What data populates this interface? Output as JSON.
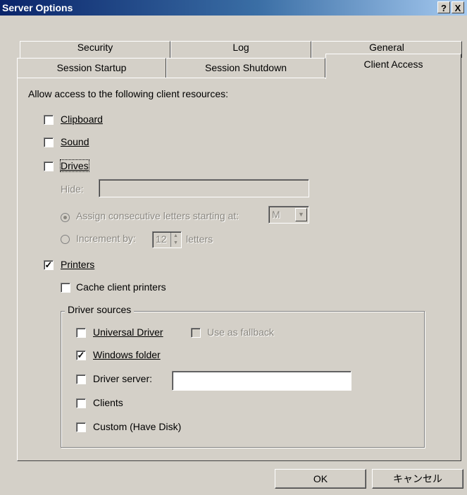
{
  "window": {
    "title": "Server Options",
    "help_label": "?",
    "close_label": "X"
  },
  "tabs": {
    "back_row": [
      "Security",
      "Log",
      "General"
    ],
    "front_row": [
      "Session Startup",
      "Session Shutdown",
      "Client Access"
    ],
    "active": "Client Access"
  },
  "panel": {
    "intro_label": "Allow access to the following client resources:",
    "clipboard": {
      "label": "Clipboard",
      "checked": false
    },
    "sound": {
      "label": "Sound",
      "checked": false
    },
    "drives": {
      "label": "Drives",
      "checked": false
    },
    "hide_label": "Hide:",
    "hide_value": "",
    "assign_label": "Assign consecutive letters starting at:",
    "assign_value": "M",
    "increment_label": "Increment by:",
    "increment_value": "12",
    "letters_label": "letters",
    "printers": {
      "label": "Printers",
      "checked": true
    },
    "cache_printers": {
      "label": "Cache client printers",
      "checked": false
    },
    "driver_sources_title": "Driver sources",
    "universal_driver": {
      "label": "Universal Driver",
      "checked": false
    },
    "use_as_fallback": {
      "label": "Use as fallback",
      "checked": false
    },
    "windows_folder": {
      "label": "Windows folder",
      "checked": true
    },
    "driver_server": {
      "label": "Driver server:",
      "checked": false,
      "value": ""
    },
    "clients": {
      "label": "Clients",
      "checked": false
    },
    "custom": {
      "label": "Custom (Have Disk)",
      "checked": false
    }
  },
  "buttons": {
    "ok_label": "OK",
    "cancel_label": "キャンセル"
  },
  "colors": {
    "title_bar_start": "#0a246a",
    "title_bar_end": "#a6caf0",
    "face": "#d4d0c8",
    "disabled_text": "#8a8780"
  }
}
